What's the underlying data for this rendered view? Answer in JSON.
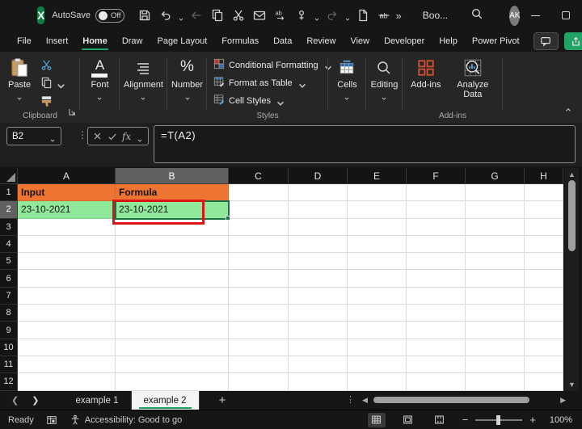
{
  "colors": {
    "accent_green": "#21A366",
    "header_fill_orange": "#ED7431",
    "cell_fill_green": "#90E89A",
    "annotation_red": "#DE1414",
    "selection_green": "#1E7145"
  },
  "title_bar": {
    "autosave_label": "AutoSave",
    "autosave_state": "Off",
    "doc_title": "Boo...",
    "avatar_initials": "AK",
    "more_glyph": "»",
    "qat": [
      {
        "name": "save",
        "disabled": false,
        "dropdown": false
      },
      {
        "name": "undo",
        "disabled": false,
        "dropdown": true
      },
      {
        "name": "back",
        "disabled": true,
        "dropdown": false
      },
      {
        "name": "copy",
        "disabled": false,
        "dropdown": false
      },
      {
        "name": "cut",
        "disabled": false,
        "dropdown": false
      },
      {
        "name": "email",
        "disabled": false,
        "dropdown": false
      },
      {
        "name": "find-replace",
        "disabled": false,
        "dropdown": false
      },
      {
        "name": "touch-mode",
        "disabled": false,
        "dropdown": true
      },
      {
        "name": "redo",
        "disabled": true,
        "dropdown": true
      },
      {
        "name": "new-file",
        "disabled": false,
        "dropdown": false
      },
      {
        "name": "strike-ab",
        "disabled": false,
        "dropdown": false
      }
    ]
  },
  "menu_bar": {
    "items": [
      {
        "label": "File",
        "active": false
      },
      {
        "label": "Insert",
        "active": false
      },
      {
        "label": "Home",
        "active": true
      },
      {
        "label": "Draw",
        "active": false
      },
      {
        "label": "Page Layout",
        "active": false
      },
      {
        "label": "Formulas",
        "active": false
      },
      {
        "label": "Data",
        "active": false
      },
      {
        "label": "Review",
        "active": false
      },
      {
        "label": "View",
        "active": false
      },
      {
        "label": "Developer",
        "active": false
      },
      {
        "label": "Help",
        "active": false
      },
      {
        "label": "Power Pivot",
        "active": false
      }
    ]
  },
  "ribbon": {
    "paste_label": "Paste",
    "clipboard_group_label": "Clipboard",
    "font_label": "Font",
    "font_icon_letter": "A",
    "alignment_label": "Alignment",
    "number_label": "Number",
    "number_icon_glyph": "%",
    "styles_items": [
      {
        "label": "Conditional Formatting",
        "icon": "conditional-formatting"
      },
      {
        "label": "Format as Table",
        "icon": "format-as-table"
      },
      {
        "label": "Cell Styles",
        "icon": "cell-styles"
      }
    ],
    "styles_group_label": "Styles",
    "cells_label": "Cells",
    "editing_label": "Editing",
    "addins_button_label": "Add-ins",
    "analyze_data_label": "Analyze Data",
    "addins_group_label": "Add-ins"
  },
  "formula_bar": {
    "name_box_value": "B2",
    "fx_label": "fx",
    "formula": "=T(A2)"
  },
  "grid": {
    "column_headers": [
      "A",
      "B",
      "C",
      "D",
      "E",
      "F",
      "G",
      "H"
    ],
    "row_headers": [
      "1",
      "2",
      "3",
      "4",
      "5",
      "6",
      "7",
      "8",
      "9",
      "10",
      "11",
      "12"
    ],
    "selected_cell": "B2",
    "selected_column": "B",
    "selected_row": "2",
    "cells": [
      {
        "ref": "A1",
        "text": "Input",
        "fill": "header"
      },
      {
        "ref": "B1",
        "text": "Formula",
        "fill": "header"
      },
      {
        "ref": "A2",
        "text": "23-10-2021",
        "fill": "data"
      },
      {
        "ref": "B2",
        "text": "23-10-2021",
        "fill": "data",
        "selected": true
      }
    ],
    "annotation": {
      "shape": "rectangle",
      "color": "#DE1414",
      "target": "B2"
    }
  },
  "sheet_tabs": {
    "tabs": [
      {
        "label": "example 1",
        "active": false
      },
      {
        "label": "example 2",
        "active": true
      }
    ]
  },
  "status_bar": {
    "ready_label": "Ready",
    "accessibility_label": "Accessibility: Good to go",
    "zoom_value": "100%"
  }
}
